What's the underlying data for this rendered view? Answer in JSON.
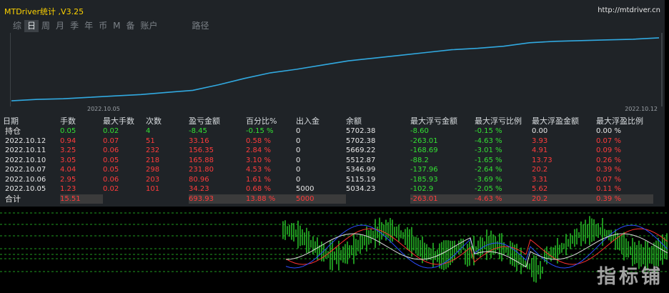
{
  "window": {
    "title": "MTDriver统计 ,V3.25",
    "url": "http://mtdriver.cn"
  },
  "tabs": [
    "综",
    "日",
    "周",
    "月",
    "季",
    "年",
    "币",
    "M",
    "备",
    "账户",
    "路径"
  ],
  "active_tab": "日",
  "equity_chart": {
    "start_label": "2022.10.05",
    "end_label": "2022.10.12",
    "line_color": "#31a9e0",
    "curve": [
      0.05,
      0.07,
      0.08,
      0.1,
      0.12,
      0.14,
      0.17,
      0.2,
      0.28,
      0.37,
      0.45,
      0.5,
      0.56,
      0.62,
      0.66,
      0.7,
      0.74,
      0.78,
      0.8,
      0.83,
      0.88,
      0.9,
      0.91,
      0.92,
      0.93,
      0.95
    ]
  },
  "stats_table": {
    "headers": [
      "日期",
      "手数",
      "最大手数",
      "次数",
      "盈亏金额",
      "百分比%",
      "出入金",
      "余额",
      "最大浮亏金额",
      "最大浮亏比例",
      "最大浮盈金额",
      "最大浮盈比例"
    ],
    "holding": {
      "label": "持仓",
      "cells": [
        {
          "v": "0.05",
          "c": "g"
        },
        {
          "v": "0.02",
          "c": "g"
        },
        {
          "v": "4",
          "c": "g"
        },
        {
          "v": "-8.45",
          "c": "g"
        },
        {
          "v": "-0.15 %",
          "c": "g"
        },
        {
          "v": "0",
          "c": "w"
        },
        {
          "v": "5702.38",
          "c": "w"
        },
        {
          "v": "-8.60",
          "c": "g"
        },
        {
          "v": "-0.15 %",
          "c": "g"
        },
        {
          "v": "0.00",
          "c": "w"
        },
        {
          "v": "0.00 %",
          "c": "w"
        }
      ]
    },
    "rows": [
      {
        "date": "2022.10.12",
        "cells": [
          "0.94",
          "0.07",
          "51",
          "33.16",
          "0.58 %",
          "0",
          "5702.38",
          "-263.01",
          "-4.63 %",
          "3.93",
          "0.07 %"
        ]
      },
      {
        "date": "2022.10.11",
        "cells": [
          "3.25",
          "0.06",
          "232",
          "156.35",
          "2.84 %",
          "0",
          "5669.22",
          "-168.69",
          "-3.01 %",
          "4.91",
          "0.09 %"
        ]
      },
      {
        "date": "2022.10.10",
        "cells": [
          "3.05",
          "0.05",
          "218",
          "165.88",
          "3.10 %",
          "0",
          "5512.87",
          "-88.2",
          "-1.65 %",
          "13.73",
          "0.26 %"
        ]
      },
      {
        "date": "2022.10.07",
        "cells": [
          "4.04",
          "0.05",
          "298",
          "231.80",
          "4.53 %",
          "0",
          "5346.99",
          "-137.96",
          "-2.64 %",
          "20.2",
          "0.39 %"
        ]
      },
      {
        "date": "2022.10.06",
        "cells": [
          "2.95",
          "0.06",
          "203",
          "80.96",
          "1.61 %",
          "0",
          "5115.19",
          "-185.93",
          "-3.69 %",
          "3.31",
          "0.07 %"
        ]
      },
      {
        "date": "2022.10.05",
        "cells": [
          "1.23",
          "0.02",
          "101",
          "34.23",
          "0.68 %",
          "5000",
          "5034.23",
          "-102.9",
          "-2.05 %",
          "5.62",
          "0.11 %"
        ]
      }
    ],
    "row_colors": [
      "r",
      "r",
      "r",
      "r",
      "r",
      "w",
      "w",
      "g",
      "g",
      "r",
      "r"
    ],
    "total": {
      "label": "合计",
      "cells": [
        "15.51",
        "",
        "",
        "693.93",
        "13.88 %",
        "5000",
        "",
        "-263.01",
        "-4.63 %",
        "20.2",
        "0.39 %"
      ],
      "colors": [
        "r",
        "",
        "",
        "r",
        "r",
        "r",
        "",
        "g",
        "g",
        "r",
        "r"
      ],
      "boxed": [
        true,
        false,
        false,
        true,
        true,
        true,
        false,
        true,
        true,
        true,
        true
      ]
    }
  },
  "watermark": "指标铺"
}
